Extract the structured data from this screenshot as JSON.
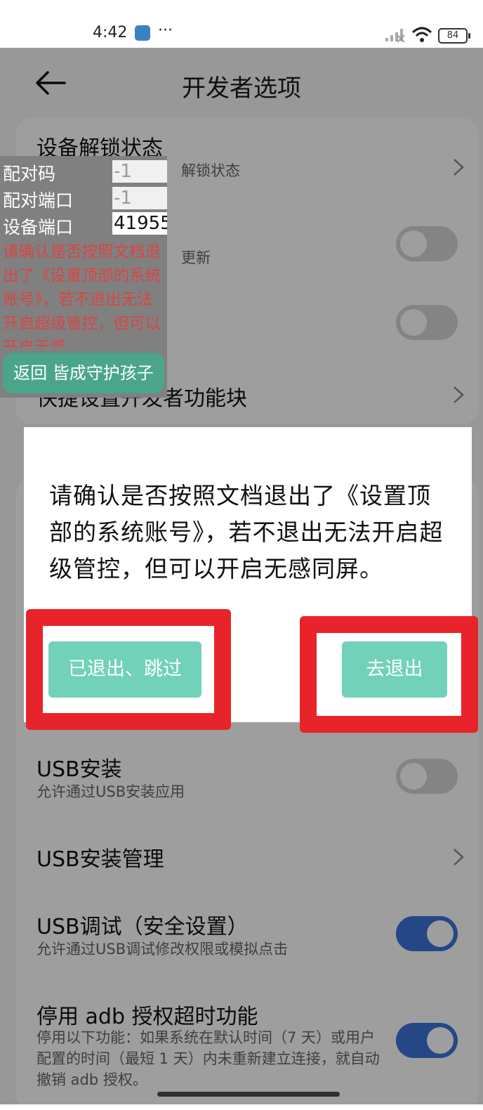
{
  "status_bar": {
    "time": "4:42",
    "dots": "···",
    "battery": "84"
  },
  "header": {
    "title": "开发者选项"
  },
  "settings": {
    "unlock_status": {
      "title": "设备解锁状态",
      "subtitle": "解锁状态"
    },
    "row2": {
      "subtitle": "更新"
    },
    "quick_tiles": {
      "title": "快捷设置开发者功能块"
    },
    "usb_install": {
      "title": "USB安装",
      "subtitle": "允许通过USB安装应用",
      "enabled": false
    },
    "usb_install_manage": {
      "title": "USB安装管理"
    },
    "usb_debug_secure": {
      "title": "USB调试（安全设置）",
      "subtitle": "允许通过USB调试修改权限或模拟点击",
      "enabled": true
    },
    "adb_timeout": {
      "title": "停用 adb 授权超时功能",
      "subtitle": "停用以下功能：如果系统在默认时间（7 天）或用户配置的时间（最短 1 天）内未重新建立连接，就自动撤销 adb 授权。",
      "enabled": true
    }
  },
  "helper_panel": {
    "pair_code_label": "配对码",
    "pair_code_value": "-1",
    "pair_port_label": "配对端口",
    "pair_port_value": "-1",
    "device_port_label": "设备端口",
    "device_port_value": "41955",
    "warning": "请确认是否按照文档退出了《设置顶部的系统账号》，若不退出无法开启超级管控，但可以开启无感",
    "button_bar": "返回 皆成守护孩子"
  },
  "dialog": {
    "message": "请确认是否按照文档退出了《设置顶部的系统账号》，若不退出无法开启超级管控，但可以开启无感同屏。",
    "skip_button": "已退出、跳过",
    "go_exit_button": "去退出"
  },
  "colors": {
    "accent_toggle": "#3d73d8",
    "dialog_button": "#72d2b9",
    "highlight_red": "#e8242a",
    "warning_red": "#d94545"
  }
}
